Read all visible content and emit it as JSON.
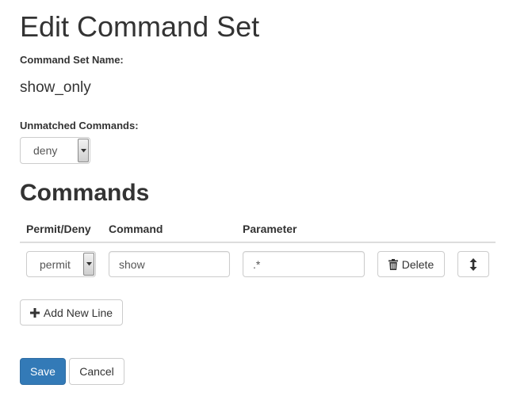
{
  "page": {
    "title": "Edit Command Set"
  },
  "command_set": {
    "name_label": "Command Set Name:",
    "name_value": "show_only"
  },
  "unmatched": {
    "label": "Unmatched Commands:",
    "selected": "deny"
  },
  "commands": {
    "section_title": "Commands",
    "columns": [
      "Permit/Deny",
      "Command",
      "Parameter"
    ],
    "rows": [
      {
        "permit_deny": "permit",
        "command": "show",
        "parameter": ".*",
        "delete_label": "Delete"
      }
    ],
    "add_line_label": "Add New Line"
  },
  "actions": {
    "save_label": "Save",
    "cancel_label": "Cancel"
  },
  "icons": {
    "dropdown": "caret-down-icon",
    "trash": "trash-icon",
    "reorder": "vertical-resize-arrows-icon",
    "add": "plus-icon"
  },
  "colors": {
    "primary": "#337ab7",
    "text": "#333333",
    "border": "#cccccc"
  }
}
